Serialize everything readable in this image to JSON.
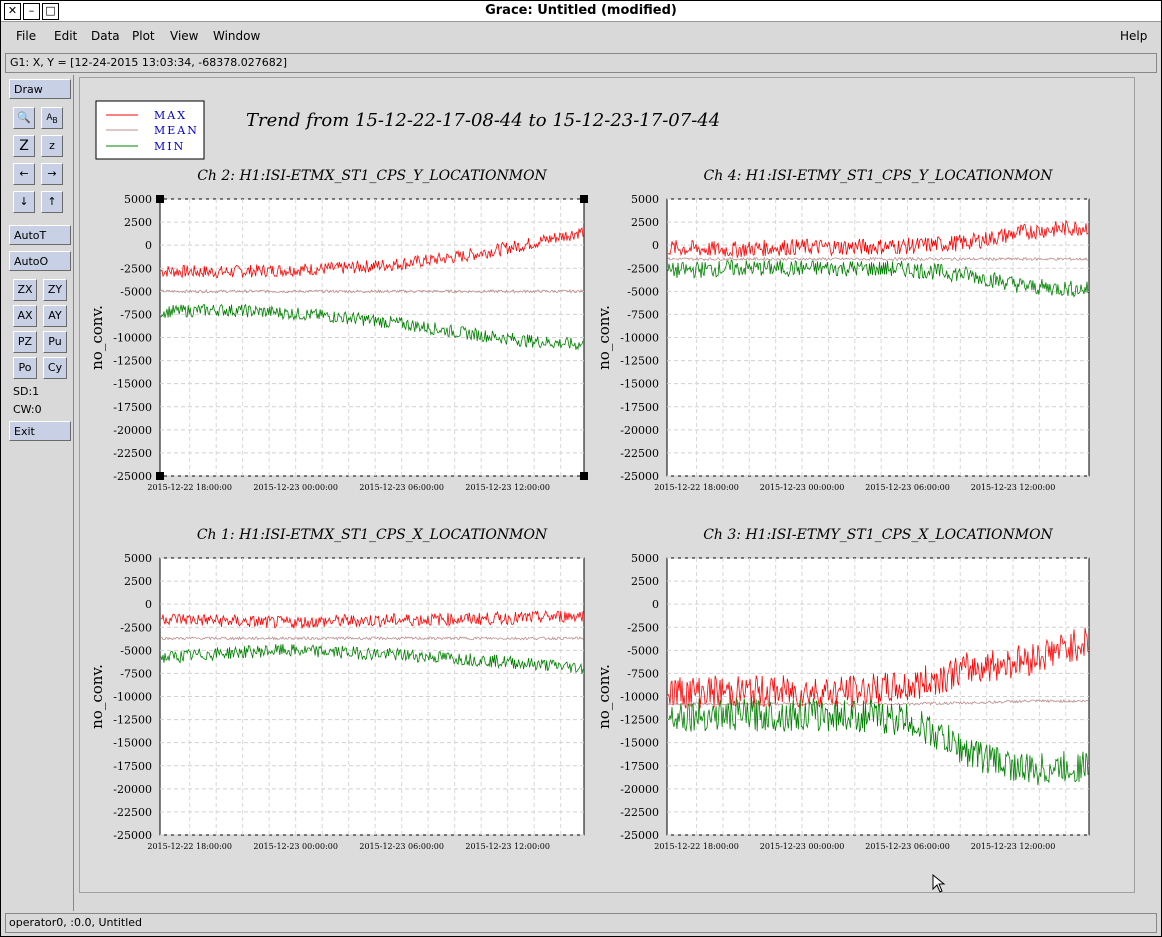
{
  "window": {
    "title": "Grace: Untitled (modified)"
  },
  "menu": {
    "file": "File",
    "edit": "Edit",
    "data": "Data",
    "plot": "Plot",
    "view": "View",
    "window": "Window",
    "help": "Help"
  },
  "locator": "G1: X, Y = [12-24-2015 13:03:34, -68378.027682]",
  "tools": {
    "draw": "Draw",
    "autot": "AutoT",
    "autoo": "AutoO",
    "zx": "ZX",
    "zy": "ZY",
    "ax": "AX",
    "ay": "AY",
    "pz": "PZ",
    "pu": "Pu",
    "po": "Po",
    "cy": "Cy",
    "sd": "SD:1",
    "cw": "CW:0",
    "exit": "Exit",
    "z_big": "Z",
    "z_small": "z"
  },
  "status": "operator0, :0.0, Untitled",
  "plot": {
    "title": "Trend from 15-12-22-17-08-44 to 15-12-23-17-07-44",
    "legend": [
      "MAX",
      "MEAN",
      "MIN"
    ],
    "colors": {
      "max": "#ff0000",
      "mean": "#bc8f8f",
      "min": "#008000"
    }
  },
  "chart_data": [
    {
      "type": "line",
      "title": "Ch 2: H1:ISI-ETMX_ST1_CPS_Y_LOCATIONMON",
      "xlabel": "",
      "ylabel": "no_conv.",
      "ylim": [
        -25000,
        5000
      ],
      "x_ticks": [
        "2015-12-22 18:00:00",
        "2015-12-23 00:00:00",
        "2015-12-23 06:00:00",
        "2015-12-23 12:00:00"
      ],
      "y_ticks": [
        5000,
        2500,
        0,
        -2500,
        -5000,
        -7500,
        -10000,
        -12500,
        -15000,
        -17500,
        -20000,
        -22500,
        -25000
      ],
      "series": [
        {
          "name": "MAX",
          "values": [
            -2800,
            -2900,
            -2700,
            -2500,
            -2000,
            -1200,
            0,
            1500
          ]
        },
        {
          "name": "MEAN",
          "values": [
            -5000,
            -5000,
            -5000,
            -5000,
            -5000,
            -5000,
            -5000,
            -5000
          ]
        },
        {
          "name": "MIN",
          "values": [
            -7200,
            -7000,
            -7300,
            -7800,
            -8500,
            -9500,
            -10300,
            -10800
          ]
        }
      ]
    },
    {
      "type": "line",
      "title": "Ch 4: H1:ISI-ETMY_ST1_CPS_Y_LOCATIONMON",
      "xlabel": "",
      "ylabel": "no_conv.",
      "ylim": [
        -25000,
        5000
      ],
      "x_ticks": [
        "2015-12-22 18:00:00",
        "2015-12-23 00:00:00",
        "2015-12-23 06:00:00",
        "2015-12-23 12:00:00"
      ],
      "y_ticks": [
        5000,
        2500,
        0,
        -2500,
        -5000,
        -7500,
        -10000,
        -12500,
        -15000,
        -17500,
        -20000,
        -22500,
        -25000
      ],
      "series": [
        {
          "name": "MAX",
          "values": [
            -300,
            -500,
            -200,
            -200,
            -100,
            300,
            1500,
            2000
          ]
        },
        {
          "name": "MEAN",
          "values": [
            -1500,
            -1500,
            -1500,
            -1500,
            -1500,
            -1500,
            -1500,
            -1500
          ]
        },
        {
          "name": "MIN",
          "values": [
            -2800,
            -2500,
            -2500,
            -2500,
            -2600,
            -3200,
            -4500,
            -4800
          ]
        }
      ]
    },
    {
      "type": "line",
      "title": "Ch 1: H1:ISI-ETMX_ST1_CPS_X_LOCATIONMON",
      "xlabel": "",
      "ylabel": "no_conv.",
      "ylim": [
        -25000,
        5000
      ],
      "x_ticks": [
        "2015-12-22 18:00:00",
        "2015-12-23 00:00:00",
        "2015-12-23 06:00:00",
        "2015-12-23 12:00:00"
      ],
      "y_ticks": [
        5000,
        2500,
        0,
        -2500,
        -5000,
        -7500,
        -10000,
        -12500,
        -15000,
        -17500,
        -20000,
        -22500,
        -25000
      ],
      "series": [
        {
          "name": "MAX",
          "values": [
            -1500,
            -1800,
            -2000,
            -1800,
            -1700,
            -1600,
            -1500,
            -1200
          ]
        },
        {
          "name": "MEAN",
          "values": [
            -3700,
            -3700,
            -3700,
            -3700,
            -3700,
            -3700,
            -3700,
            -3700
          ]
        },
        {
          "name": "MIN",
          "values": [
            -5800,
            -5300,
            -5000,
            -5200,
            -5500,
            -5900,
            -6400,
            -6900
          ]
        }
      ]
    },
    {
      "type": "line",
      "title": "Ch 3: H1:ISI-ETMY_ST1_CPS_X_LOCATIONMON",
      "xlabel": "",
      "ylabel": "no_conv.",
      "ylim": [
        -25000,
        5000
      ],
      "x_ticks": [
        "2015-12-22 18:00:00",
        "2015-12-23 00:00:00",
        "2015-12-23 06:00:00",
        "2015-12-23 12:00:00"
      ],
      "y_ticks": [
        5000,
        2500,
        0,
        -2500,
        -5000,
        -7500,
        -10000,
        -12500,
        -15000,
        -17500,
        -20000,
        -22500,
        -25000
      ],
      "series": [
        {
          "name": "MAX",
          "values": [
            -9500,
            -9500,
            -9500,
            -9500,
            -9000,
            -7000,
            -6000,
            -4000
          ]
        },
        {
          "name": "MEAN",
          "values": [
            -10800,
            -10800,
            -10800,
            -10800,
            -10800,
            -10700,
            -10500,
            -10500
          ]
        },
        {
          "name": "MIN",
          "values": [
            -12000,
            -12000,
            -12000,
            -12000,
            -12500,
            -16000,
            -18000,
            -17500
          ]
        }
      ]
    }
  ]
}
